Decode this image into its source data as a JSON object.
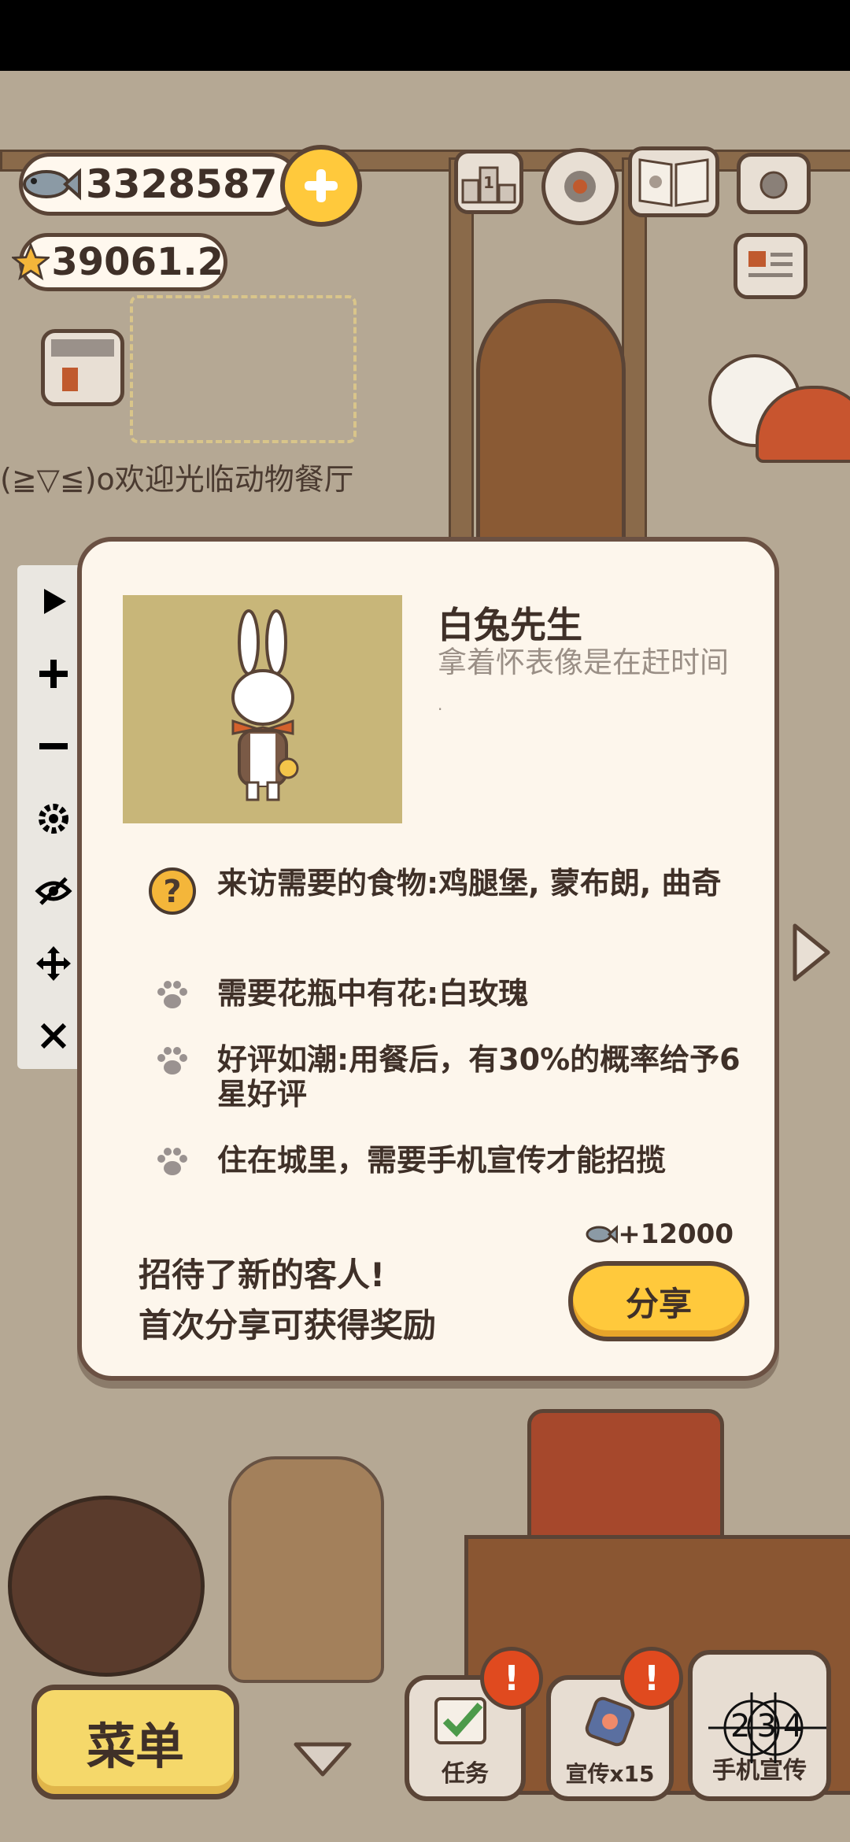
{
  "currency": {
    "fish_amount": "3328587",
    "star_amount": "39061.2"
  },
  "marquee": "(≧▽≦)o欢迎光临动物餐厅",
  "customer": {
    "name": "白兔先生",
    "description": "拿着怀表像是在赶时间",
    "description_tail": ".",
    "requirements": [
      "来访需要的食物:鸡腿堡, 蒙布朗, 曲奇",
      "需要花瓶中有花:白玫瑰",
      "好评如潮:用餐后，有30%的概率给予6星好评",
      "住在城里，需要手机宣传才能招揽"
    ]
  },
  "share": {
    "line1": "招待了新的客人!",
    "line2": "首次分享可获得奖励",
    "reward": "+12000",
    "button": "分享"
  },
  "bottom": {
    "menu": "菜单",
    "tasks": "任务",
    "promo": "宣传x15",
    "phone": "手机宣传",
    "counter": "234"
  },
  "colors": {
    "panel_bg": "#fdf6ec",
    "panel_border": "#6b5143",
    "share_button": "#ffc93c",
    "portrait_bg": "#c8b679",
    "badge": "#e04a1f"
  }
}
